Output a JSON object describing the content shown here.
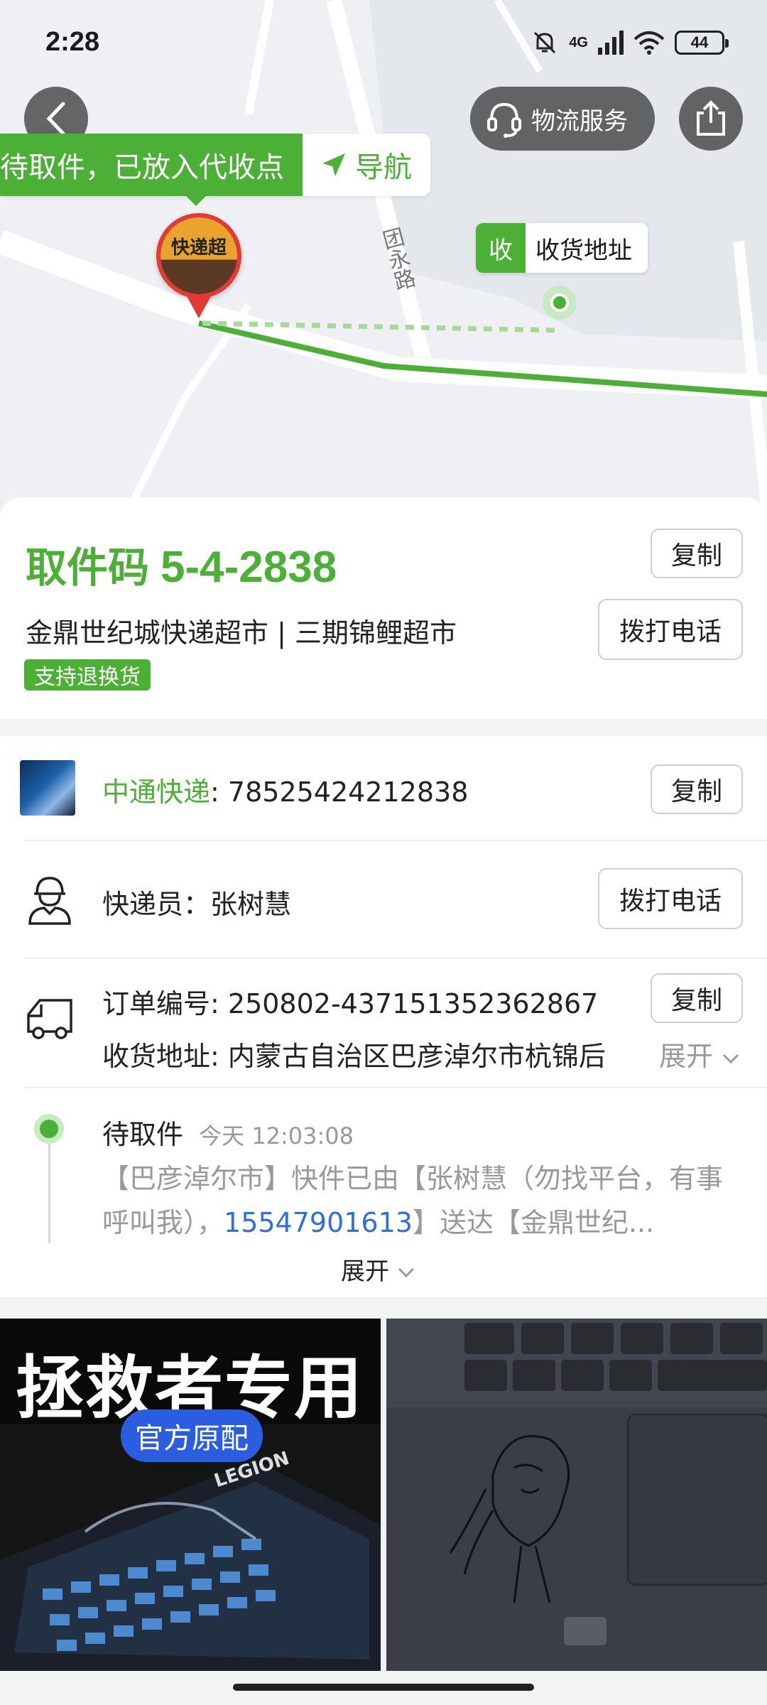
{
  "status_bar": {
    "time": "2:28",
    "network": "4G",
    "battery": "44"
  },
  "map": {
    "service_label": "物流服务",
    "banner_status": "待取件，已放入代收点",
    "banner_nav": "导航",
    "store_pin_text": "快递超",
    "recv_badge": "收",
    "recv_label": "收货地址",
    "road_name": "团永路"
  },
  "pickup": {
    "label": "取件码",
    "code": "5-4-2838",
    "copy_label": "复制",
    "store": "金鼎世纪城快递超市 | 三期锦鲤超市",
    "call_label": "拨打电话",
    "return_badge": "支持退换货"
  },
  "shipment": {
    "carrier": "中通快递",
    "tracking_sep": ": ",
    "tracking_no": "78525424212838",
    "copy_label": "复制",
    "courier_label": "快递员：",
    "courier_name": "张树慧",
    "call_label": "拨打电话",
    "order_label": "订单编号: ",
    "order_no": "250802-437151352362867",
    "order_copy_label": "复制",
    "address_label": "收货地址: ",
    "address": "内蒙古自治区巴彦淖尔市杭锦后",
    "expand_label": "展开"
  },
  "tracking": {
    "status": "待取件",
    "time": "今天 12:03:08",
    "text_part1": "【巴彦淖尔市】快件已由【张树慧（勿找平台，有事呼叫我），",
    "phone": "15547901613",
    "text_part2": "】送达【金鼎世纪...",
    "expand_label": "展开"
  },
  "products": {
    "item1_headline": "拯救者专用",
    "item1_badge": "官方原配",
    "item1_brand": "LEGION"
  }
}
